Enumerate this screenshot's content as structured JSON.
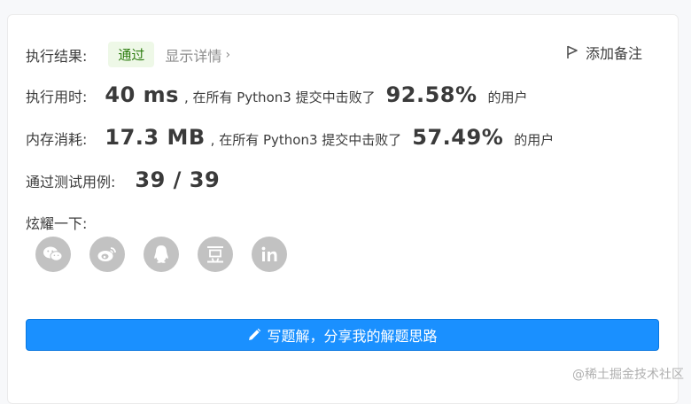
{
  "result": {
    "label": "执行结果:",
    "status": "通过",
    "detail_link": "显示详情",
    "add_note": "添加备注"
  },
  "runtime": {
    "label": "执行用时:",
    "value": "40 ms",
    "middle": ", 在所有 Python3 提交中击败了",
    "percent": "92.58%",
    "tail": "的用户"
  },
  "memory": {
    "label": "内存消耗:",
    "value": "17.3 MB",
    "middle": ", 在所有 Python3 提交中击败了",
    "percent": "57.49%",
    "tail": "的用户"
  },
  "tests": {
    "label": "通过测试用例:",
    "value": "39 / 39"
  },
  "share": {
    "label": "炫耀一下:",
    "icons": [
      "wechat-icon",
      "weibo-icon",
      "qq-icon",
      "douban-icon",
      "linkedin-icon"
    ]
  },
  "write_solution_button": "写题解，分享我的解题思路",
  "watermark": "@稀土掘金技术社区",
  "colors": {
    "accent": "#1a90ff",
    "badge_bg": "#eef8e7",
    "badge_text": "#2d7d10",
    "icon_gray": "#c2c2c2"
  }
}
